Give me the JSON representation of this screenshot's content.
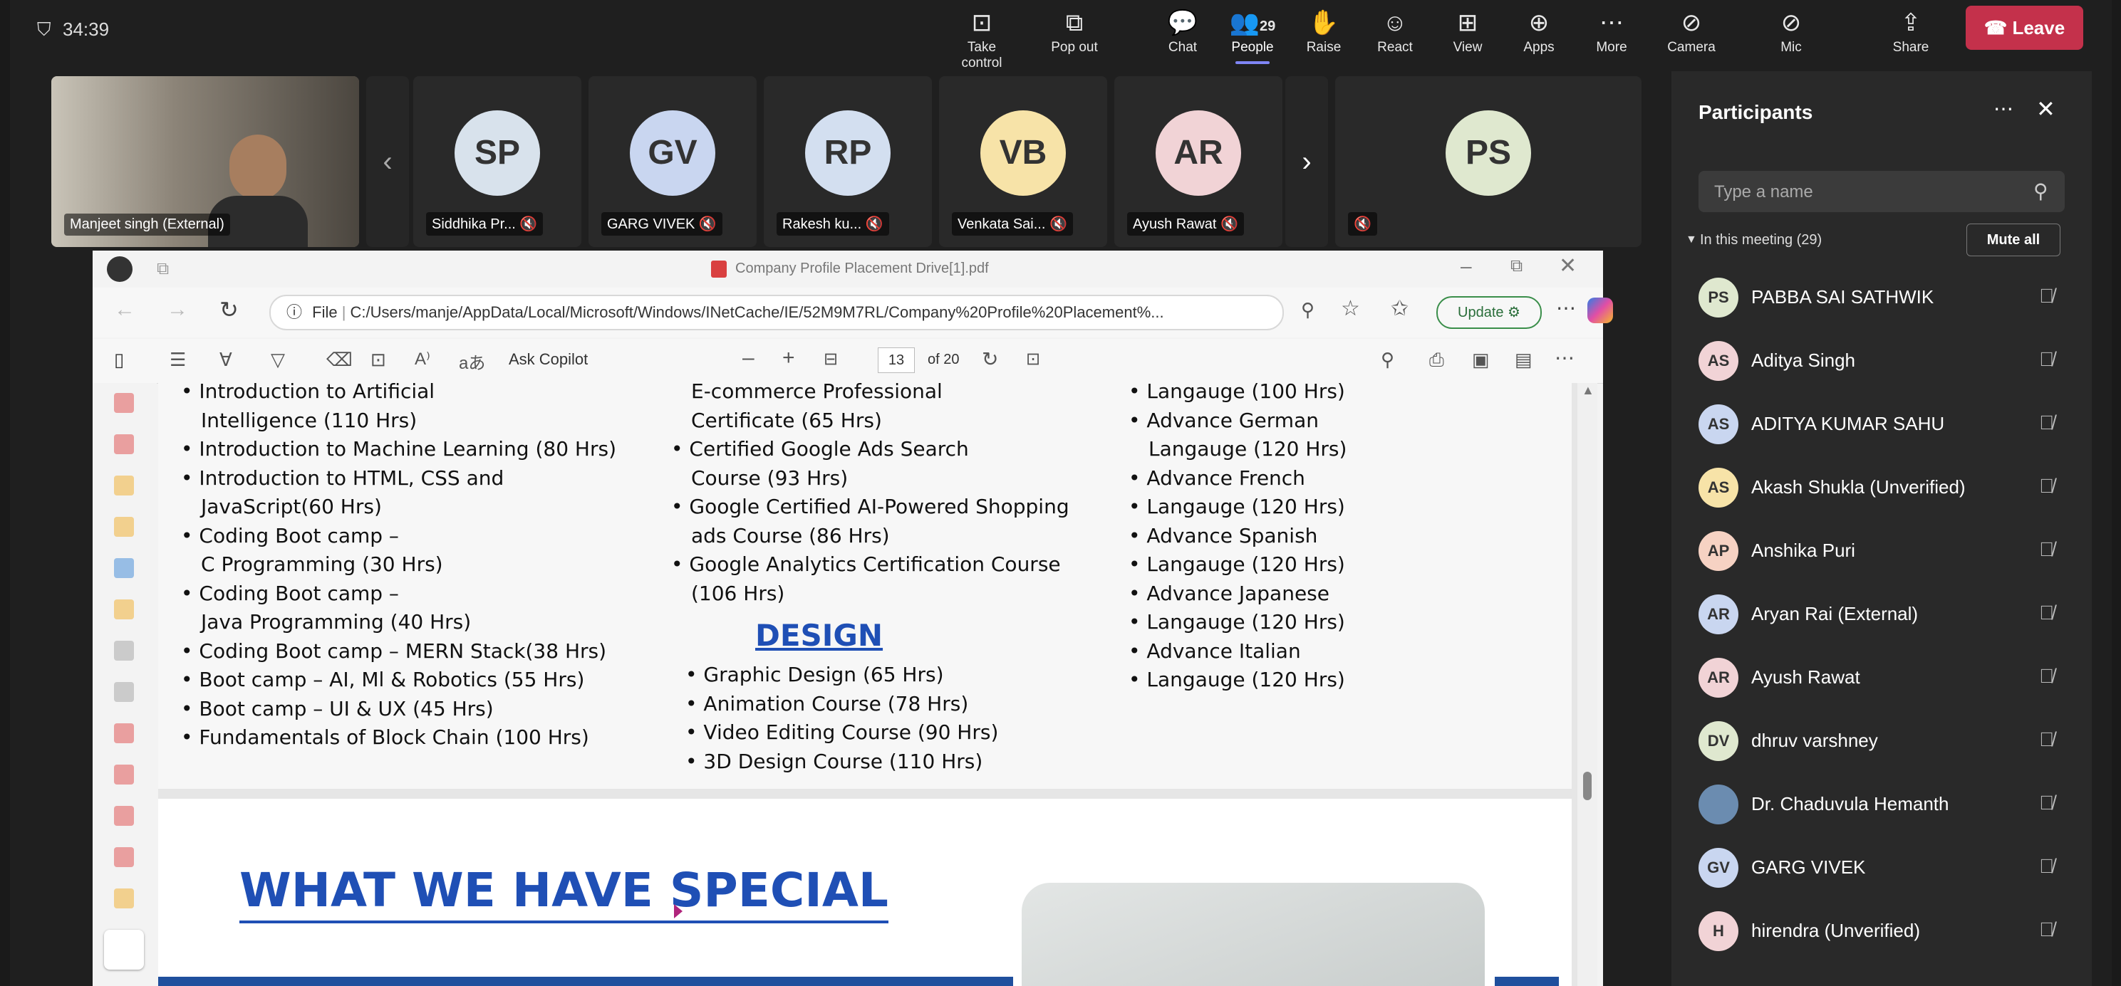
{
  "topbar": {
    "timer": "34:39",
    "buttons": [
      {
        "label": "Take control",
        "icon": "take-control-icon",
        "glyph": "⊡"
      },
      {
        "label": "Pop out",
        "icon": "pop-out-icon",
        "glyph": "⧉"
      },
      {
        "label": "Chat",
        "icon": "chat-icon",
        "glyph": "💬"
      },
      {
        "label": "People",
        "icon": "people-icon",
        "glyph": "👥",
        "count": "29"
      },
      {
        "label": "Raise",
        "icon": "raise-hand-icon",
        "glyph": "✋"
      },
      {
        "label": "React",
        "icon": "react-icon",
        "glyph": "☺"
      },
      {
        "label": "View",
        "icon": "view-icon",
        "glyph": "⊞"
      },
      {
        "label": "Apps",
        "icon": "apps-icon",
        "glyph": "⊕"
      },
      {
        "label": "More",
        "icon": "more-icon",
        "glyph": "⋯"
      },
      {
        "label": "Camera",
        "icon": "camera-off-icon",
        "glyph": "⊘"
      },
      {
        "label": "Mic",
        "icon": "mic-off-icon",
        "glyph": "⊘"
      },
      {
        "label": "Share",
        "icon": "share-icon",
        "glyph": "⇪"
      }
    ],
    "leave": "Leave"
  },
  "videos": [
    {
      "initials": "SP",
      "name": "Siddhika Pr...",
      "color": "#d8e2ec"
    },
    {
      "initials": "GV",
      "name": "GARG VIVEK",
      "color": "#c9d6f0"
    },
    {
      "initials": "RP",
      "name": "Rakesh ku...",
      "color": "#d3dff0"
    },
    {
      "initials": "VB",
      "name": "Venkata Sai...",
      "color": "#f7e3a8"
    },
    {
      "initials": "AR",
      "name": "Ayush Rawat",
      "color": "#f1d3d6"
    }
  ],
  "self_video": {
    "name": "Manjeet singh (External)"
  },
  "last_video": {
    "initials": "PS",
    "color": "#dfe8cf"
  },
  "browser": {
    "tab_title": "Company Profile Placement Drive[1].pdf",
    "url_prefix": "File",
    "url": "C:/Users/manje/AppData/Local/Microsoft/Windows/INetCache/IE/52M9M7RL/Company%20Profile%20Placement%...",
    "update": "Update",
    "ask_copilot": "Ask Copilot",
    "page_current": "13",
    "page_total": "of 20"
  },
  "pdf": {
    "col1": [
      {
        "t": "Introduction to Artificial",
        "b": true
      },
      {
        "t": "Intelligence (110 Hrs)",
        "b": false
      },
      {
        "t": "Introduction to Machine Learning (80 Hrs)",
        "b": true
      },
      {
        "t": "Introduction to HTML, CSS and",
        "b": true
      },
      {
        "t": "JavaScript(60 Hrs)",
        "b": false
      },
      {
        "t": "Coding Boot camp –",
        "b": true
      },
      {
        "t": "C Programming (30 Hrs)",
        "b": false
      },
      {
        "t": "Coding Boot camp –",
        "b": true
      },
      {
        "t": "Java Programming (40 Hrs)",
        "b": false
      },
      {
        "t": "Coding Boot camp – MERN Stack(38 Hrs)",
        "b": true
      },
      {
        "t": "Boot camp – AI, Ml & Robotics (55 Hrs)",
        "b": true
      },
      {
        "t": "Boot camp – UI & UX (45 Hrs)",
        "b": true
      },
      {
        "t": "Fundamentals of Block Chain (100 Hrs)",
        "b": true
      }
    ],
    "col2": [
      {
        "t": "E-commerce Professional",
        "b": false
      },
      {
        "t": "Certificate (65 Hrs)",
        "b": false
      },
      {
        "t": "Certified Google Ads Search",
        "b": true
      },
      {
        "t": "Course (93 Hrs)",
        "b": false
      },
      {
        "t": "Google Certified AI-Powered Shopping",
        "b": true
      },
      {
        "t": "ads Course (86 Hrs)",
        "b": false
      },
      {
        "t": "Google Analytics Certification Course",
        "b": true
      },
      {
        "t": "(106 Hrs)",
        "b": false
      }
    ],
    "design_heading": "DESIGN",
    "design": [
      "Graphic Design (65 Hrs)",
      "Animation Course (78 Hrs)",
      "Video Editing Course (90 Hrs)",
      "3D Design Course (110 Hrs)"
    ],
    "col3": [
      {
        "t": "Langauge (100 Hrs)",
        "b": true
      },
      {
        "t": "Advance German",
        "b": true
      },
      {
        "t": "Langauge (120 Hrs)",
        "b": false
      },
      {
        "t": "Advance French",
        "b": true
      },
      {
        "t": "Langauge (120 Hrs)",
        "b": true
      },
      {
        "t": "Advance Spanish",
        "b": true
      },
      {
        "t": "Langauge (120 Hrs)",
        "b": true
      },
      {
        "t": "Advance Japanese",
        "b": true
      },
      {
        "t": "Langauge (120 Hrs)",
        "b": true
      },
      {
        "t": "Advance Italian",
        "b": true
      },
      {
        "t": "Langauge (120 Hrs)",
        "b": true
      }
    ],
    "special_heading": "WHAT WE HAVE SPECIAL"
  },
  "participants": {
    "title": "Participants",
    "search_placeholder": "Type a name",
    "in_meeting": "In this meeting (29)",
    "mute_all": "Mute all",
    "list": [
      {
        "initials": "PS",
        "name": "PABBA SAI SATHWIK",
        "color": "#dfe8cf"
      },
      {
        "initials": "AS",
        "name": "Aditya Singh",
        "color": "#f1d3d6"
      },
      {
        "initials": "AS",
        "name": "ADITYA KUMAR SAHU",
        "color": "#c9d6f0"
      },
      {
        "initials": "AS",
        "name": "Akash Shukla (Unverified)",
        "color": "#f7e3a8"
      },
      {
        "initials": "AP",
        "name": "Anshika Puri",
        "color": "#f6d2c3"
      },
      {
        "initials": "AR",
        "name": "Aryan Rai (External)",
        "color": "#c9d6f0"
      },
      {
        "initials": "AR",
        "name": "Ayush Rawat",
        "color": "#f1d3d6"
      },
      {
        "initials": "DV",
        "name": "dhruv varshney",
        "color": "#dfe8cf"
      },
      {
        "initials": "",
        "name": "Dr. Chaduvula Hemanth",
        "color": "#6b8cb0"
      },
      {
        "initials": "GV",
        "name": "GARG VIVEK",
        "color": "#c9d6f0"
      },
      {
        "initials": "H",
        "name": "hirendra (Unverified)",
        "color": "#f1d3d6"
      }
    ]
  }
}
